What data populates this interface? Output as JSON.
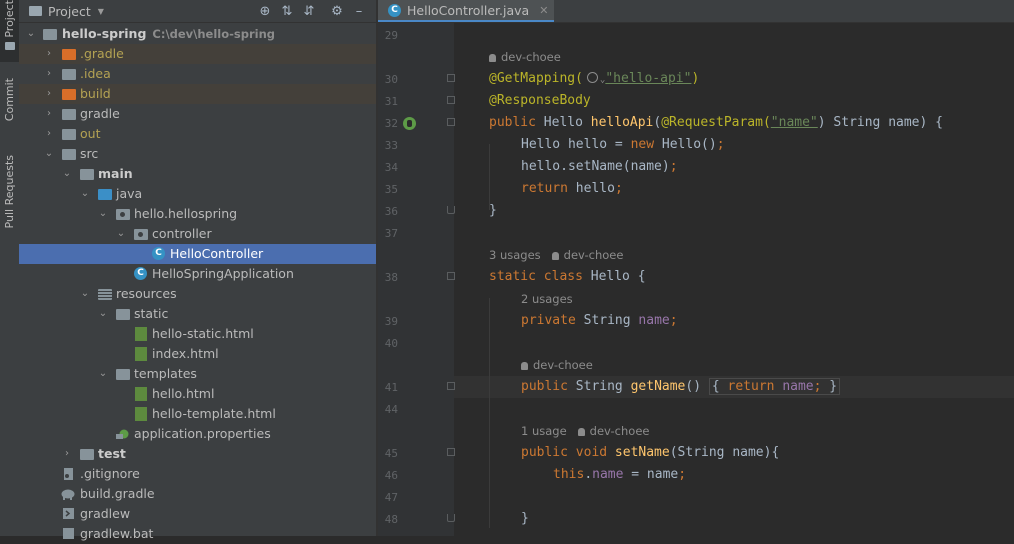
{
  "side_tabs": [
    {
      "label": "Project"
    },
    {
      "label": "Commit"
    },
    {
      "label": "Pull Requests"
    }
  ],
  "project_panel": {
    "title": "Project",
    "tools": [
      "target-icon",
      "expand-all-icon",
      "collapse-all-icon",
      "gear-icon",
      "minimize-icon"
    ]
  },
  "tree": [
    {
      "label": "hello-spring",
      "hint": "C:\\dev\\hello-spring"
    },
    {
      "label": ".gradle"
    },
    {
      "label": ".idea"
    },
    {
      "label": "build"
    },
    {
      "label": "gradle"
    },
    {
      "label": "out"
    },
    {
      "label": "src"
    },
    {
      "label": "main"
    },
    {
      "label": "java"
    },
    {
      "label": "hello.hellospring"
    },
    {
      "label": "controller"
    },
    {
      "label": "HelloController"
    },
    {
      "label": "HelloSpringApplication"
    },
    {
      "label": "resources"
    },
    {
      "label": "static"
    },
    {
      "label": "hello-static.html"
    },
    {
      "label": "index.html"
    },
    {
      "label": "templates"
    },
    {
      "label": "hello.html"
    },
    {
      "label": "hello-template.html"
    },
    {
      "label": "application.properties"
    },
    {
      "label": "test"
    },
    {
      "label": ".gitignore"
    },
    {
      "label": "build.gradle"
    },
    {
      "label": "gradlew"
    },
    {
      "label": "gradlew.bat"
    }
  ],
  "editor": {
    "tab_label": "HelloController.java",
    "line_numbers": [
      "29",
      "30",
      "31",
      "32",
      "33",
      "34",
      "35",
      "36",
      "37",
      "38",
      "39",
      "40",
      "41",
      "44",
      "45",
      "46",
      "47",
      "48"
    ],
    "meta": {
      "author": "dev-choee",
      "usages_3": "3 usages",
      "usages_2": "2 usages",
      "usage_1": "1 usage"
    },
    "code": {
      "getmapping": "@GetMapping(",
      "getmapping_path": "\"hello-api\"",
      "getmapping_close": ")",
      "responsebody": "@ResponseBody",
      "l32_public": "public ",
      "l32_type": "Hello ",
      "l32_method": "helloApi",
      "l32_paren": "(",
      "l32_ann": "@RequestParam(",
      "l32_str": "\"name\"",
      "l32_rest": ") String name) {",
      "l33_type": "Hello hello = ",
      "l33_new": "new ",
      "l33_rest": "Hello()",
      "l33_semi": ";",
      "l34": "hello.setName(name)",
      "l34_semi": ";",
      "l35_kw": "return ",
      "l35_rest": "hello",
      "l35_semi": ";",
      "l36": "}",
      "l38_kw": "static class ",
      "l38_rest": "Hello {",
      "l39_kw": "private ",
      "l39_type": "String ",
      "l39_field": "name",
      "l39_semi": ";",
      "l41_kw": "public ",
      "l41_type": "String ",
      "l41_method": "getName",
      "l41_paren": "() ",
      "l41_open": "{ ",
      "l41_ret": "return ",
      "l41_field": "name",
      "l41_semi": "; ",
      "l41_close": "}",
      "l45_kw": "public void ",
      "l45_method": "setName",
      "l45_rest": "(String name){",
      "l46_this": "this",
      "l46_dot": ".",
      "l46_field": "name",
      "l46_rest": " = name",
      "l46_semi": ";",
      "l48": "}"
    }
  }
}
